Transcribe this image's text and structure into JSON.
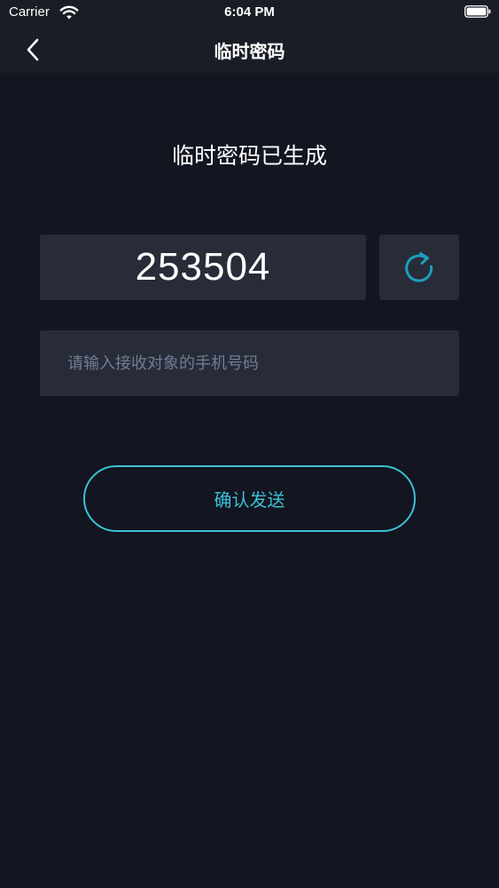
{
  "status_bar": {
    "carrier": "Carrier",
    "time": "6:04 PM",
    "icons": [
      "wifi-icon",
      "battery-icon"
    ]
  },
  "nav": {
    "title": "临时密码",
    "back_icon": "chevron-left-icon"
  },
  "main": {
    "heading": "临时密码已生成",
    "password": "253504",
    "refresh_icon": "refresh-icon",
    "phone_placeholder": "请输入接收对象的手机号码",
    "phone_value": "",
    "confirm_label": "确认发送"
  },
  "colors": {
    "background": "#131520",
    "nav_background": "#1a1d26",
    "field_background": "#272c38",
    "accent": "#39c2d6",
    "placeholder": "#737c94"
  }
}
